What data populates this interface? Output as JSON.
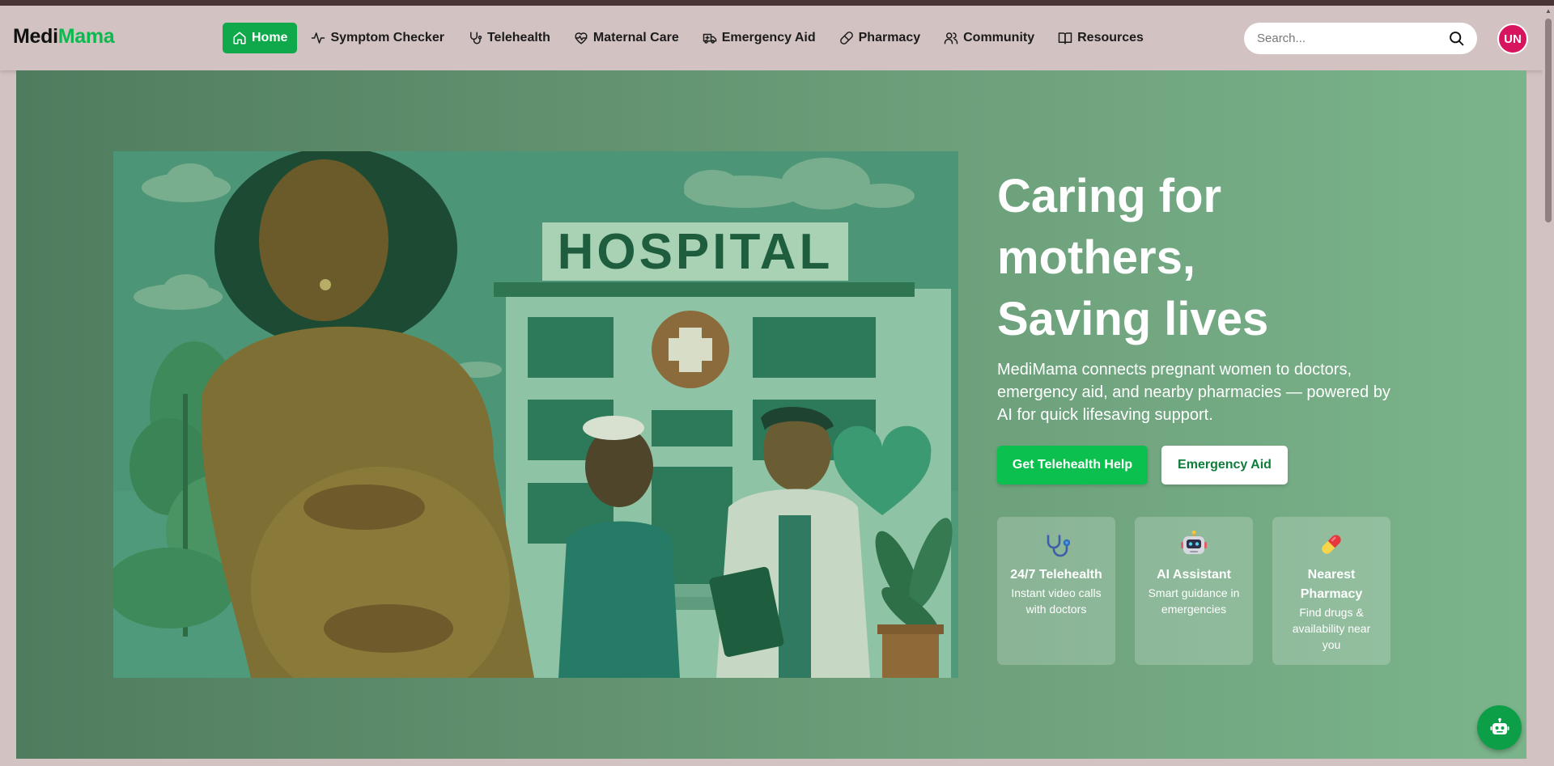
{
  "brand": {
    "part1": "Medi",
    "part2": "Mama"
  },
  "nav": {
    "items": [
      {
        "label": "Home",
        "icon": "home-icon",
        "active": true
      },
      {
        "label": "Symptom Checker",
        "icon": "activity-icon"
      },
      {
        "label": "Telehealth",
        "icon": "stethoscope-icon"
      },
      {
        "label": "Maternal Care",
        "icon": "heart-pulse-icon"
      },
      {
        "label": "Emergency Aid",
        "icon": "ambulance-icon"
      },
      {
        "label": "Pharmacy",
        "icon": "pill-icon"
      },
      {
        "label": "Community",
        "icon": "users-icon"
      },
      {
        "label": "Resources",
        "icon": "book-open-icon"
      }
    ]
  },
  "search": {
    "placeholder": "Search..."
  },
  "user": {
    "initials": "UN"
  },
  "hero": {
    "title_lines": [
      "Caring for",
      "mothers,",
      "Saving lives"
    ],
    "description": "MediMama connects pregnant women to doctors, emergency aid, and nearby pharmacies — powered by AI for quick lifesaving support.",
    "primary_button": "Get Telehealth Help",
    "secondary_button": "Emergency Aid",
    "illustration_sign": "HOSPITAL"
  },
  "features": [
    {
      "icon": "stethoscope-icon",
      "title": "24/7 Telehealth",
      "description": "Instant video calls with doctors"
    },
    {
      "icon": "robot-icon",
      "title": "AI Assistant",
      "description": "Smart guidance in emergencies"
    },
    {
      "icon": "pill-icon",
      "title": "Nearest Pharmacy",
      "description": "Find drugs & availability near you"
    }
  ],
  "colors": {
    "accent": "#0bba4f",
    "nav_active": "#0fa84a",
    "navbar_bg": "#d3c2c2",
    "avatar": "#d9145f",
    "hero_gradient_start": "#4f7c5e",
    "hero_gradient_end": "#7bb48b"
  }
}
